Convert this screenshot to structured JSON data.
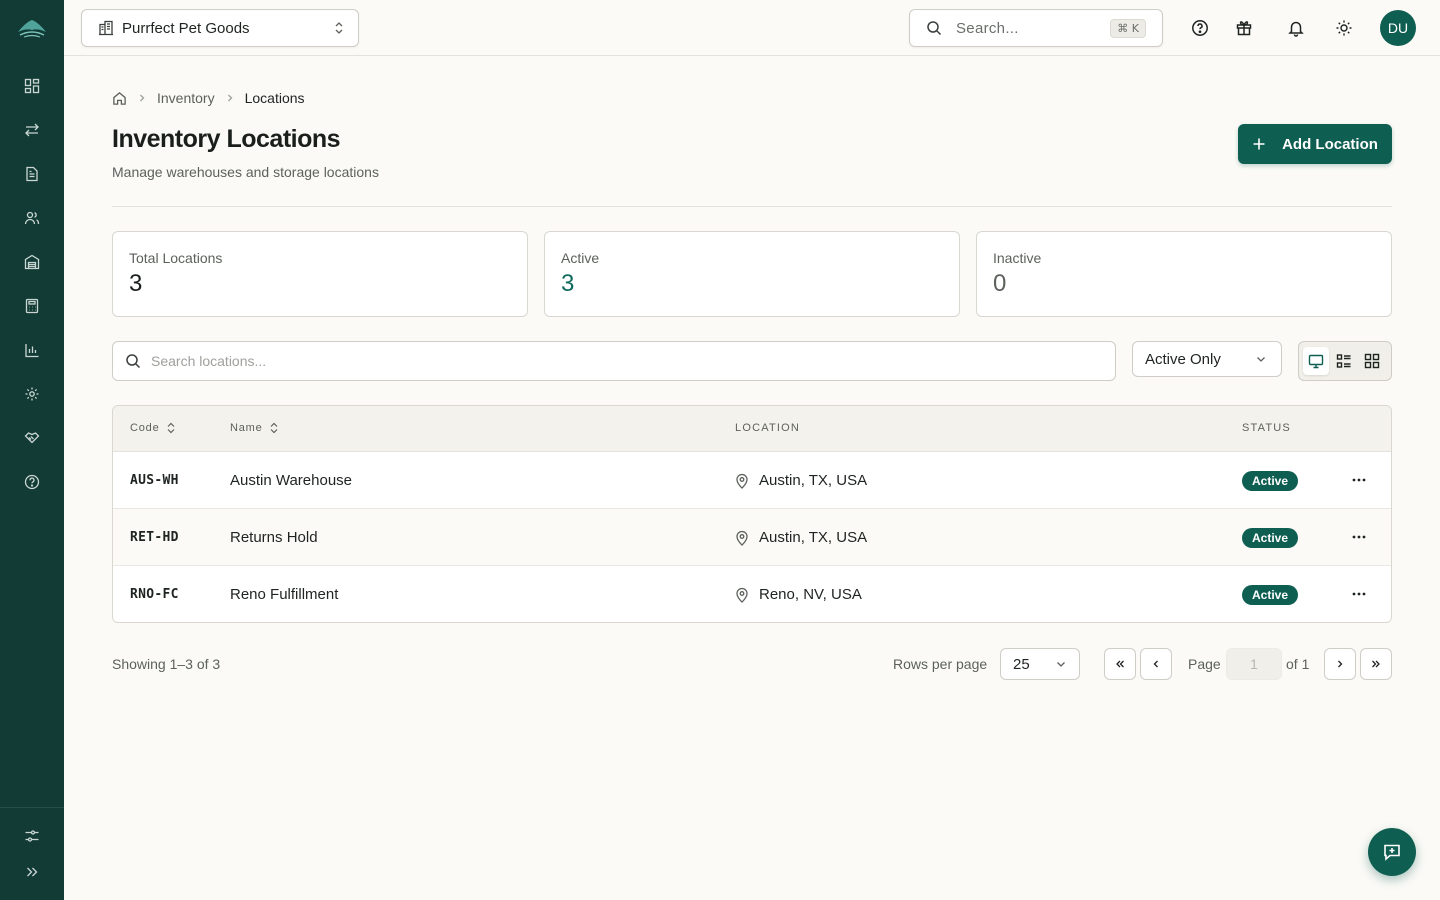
{
  "topbar": {
    "store_name": "Purrfect Pet Goods",
    "search_placeholder": "Search...",
    "search_shortcut": "⌘ K",
    "avatar_initials": "DU",
    "icons": [
      "help-circle-icon",
      "gift-icon",
      "bell-icon",
      "sun-icon"
    ]
  },
  "sidebar": {
    "items": [
      {
        "icon": "dashboard-icon"
      },
      {
        "icon": "transfer-icon"
      },
      {
        "icon": "document-icon"
      },
      {
        "icon": "users-icon"
      },
      {
        "icon": "warehouse-icon"
      },
      {
        "icon": "calculator-icon"
      },
      {
        "icon": "bar-chart-icon"
      },
      {
        "icon": "settings-icon"
      },
      {
        "icon": "handshake-icon"
      },
      {
        "icon": "help-icon"
      }
    ],
    "bottom_items": [
      {
        "icon": "sliders-icon"
      },
      {
        "icon": "expand-icon"
      }
    ]
  },
  "breadcrumb": {
    "items": [
      {
        "label": "Inventory"
      },
      {
        "label": "Locations"
      }
    ]
  },
  "page": {
    "title": "Inventory Locations",
    "subtitle": "Manage warehouses and storage locations",
    "add_button_label": "Add Location"
  },
  "stats": [
    {
      "label": "Total Locations",
      "value": "3"
    },
    {
      "label": "Active",
      "value": "3"
    },
    {
      "label": "Inactive",
      "value": "0"
    }
  ],
  "filters": {
    "search_placeholder": "Search locations...",
    "status_filter": "Active Only",
    "view_modes": [
      "table-view-icon",
      "list-view-icon",
      "grid-view-icon"
    ],
    "active_view": "table-view-icon"
  },
  "table": {
    "columns": [
      "Code",
      "Name",
      "LOCATION",
      "STATUS"
    ],
    "rows": [
      {
        "code": "AUS-WH",
        "name": "Austin Warehouse",
        "location": "Austin, TX, USA",
        "status": "Active"
      },
      {
        "code": "RET-HD",
        "name": "Returns Hold",
        "location": "Austin, TX, USA",
        "status": "Active"
      },
      {
        "code": "RNO-FC",
        "name": "Reno Fulfillment",
        "location": "Reno, NV, USA",
        "status": "Active"
      }
    ]
  },
  "pagination": {
    "showing": "Showing 1–3 of 3",
    "rows_per_page_label": "Rows per page",
    "rows_per_page": "25",
    "page_label": "Page",
    "current_page": "1",
    "of_label": "of 1"
  },
  "colors": {
    "brand": "#0f5e52",
    "sidebar": "#133b36",
    "background": "#fbfaf6"
  }
}
